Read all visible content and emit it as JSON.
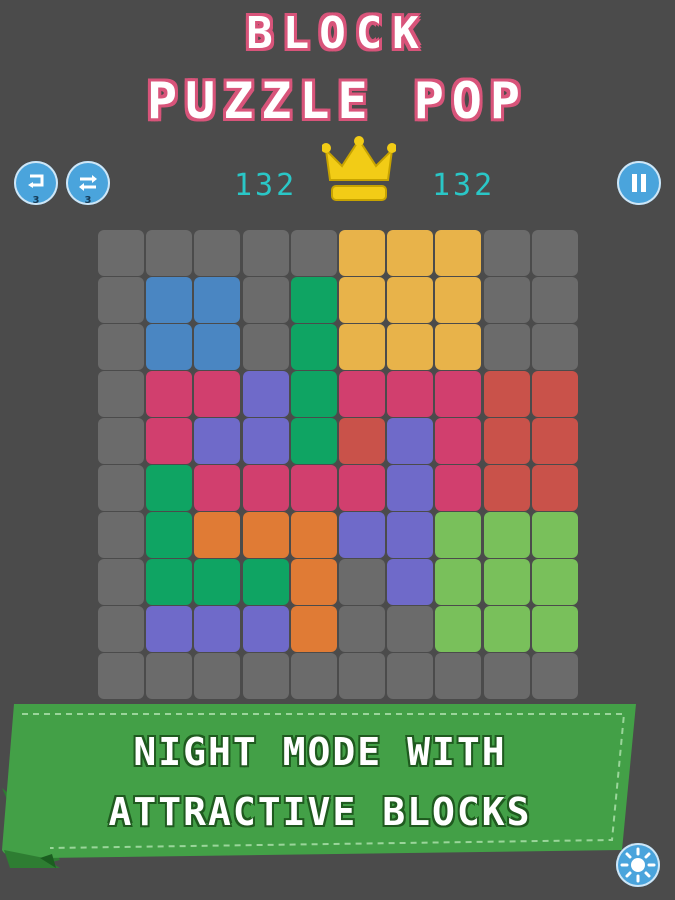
{
  "title": {
    "line1": "BLOCK",
    "line2": "PUZZLE POP"
  },
  "toolbar": {
    "undo_count": "3",
    "swap_count": "3",
    "score": "132",
    "best_score": "132"
  },
  "icons": {
    "undo": "undo-icon",
    "swap": "swap-icon",
    "crown": "crown-icon",
    "pause": "pause-icon",
    "night_mode": "sun-icon"
  },
  "colors": {
    "background": "#4b4b4b",
    "empty": "#6b6b6b",
    "title_outline": "#d8547a",
    "score_text": "#2ac7c7",
    "button": "#4aa4dc",
    "banner": "#43a047"
  },
  "palette": {
    "E": "#6b6b6b",
    "Y": "#e8b34a",
    "B": "#4a86c2",
    "G": "#0fa463",
    "P": "#d13f6e",
    "V": "#6f6ac9",
    "R": "#c9524a",
    "O": "#e07b35",
    "L": "#79c05b"
  },
  "board": [
    "EEEEEYYYEE",
    "EBBEGYYYEE",
    "EBBEGYYYEE",
    "EPPVGPPPRR",
    "EPVVGRVPRR",
    "EGPPPPVPRR",
    "EGOOOVVLLL",
    "EGGGOEVLLL",
    "EVVVOEELLL",
    "EEEEEEEEEE"
  ],
  "banner": {
    "line1": "NIGHT MODE WITH",
    "line2": "ATTRACTIVE BLOCKS"
  }
}
